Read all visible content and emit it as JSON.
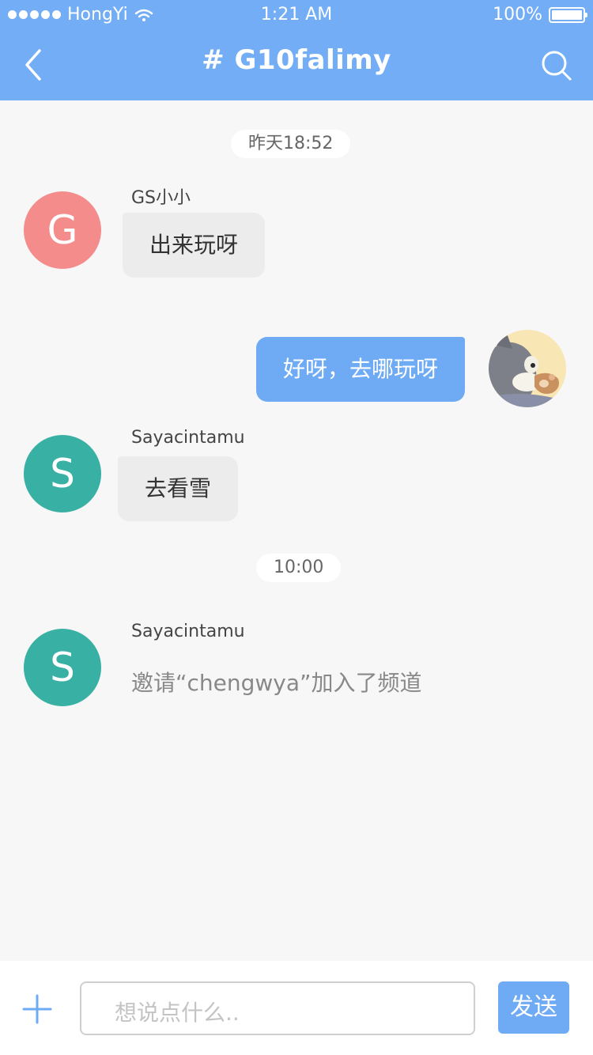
{
  "status_bar": {
    "carrier": "HongYi",
    "time": "1:21 AM",
    "battery": "100%",
    "battery_level": 1.0
  },
  "nav": {
    "title": "# G10falimy",
    "back_icon": "chevron-left-icon",
    "search_icon": "search-icon"
  },
  "messages": {
    "time1": "昨天18:52",
    "m1": {
      "sender": "GS小小",
      "avatar_letter": "G",
      "avatar_color": "#f48c8c",
      "text": "出来玩呀"
    },
    "m2": {
      "text": "好呀，去哪玩呀"
    },
    "m3": {
      "sender": "Sayacintamu",
      "avatar_letter": "S",
      "avatar_color": "#38b0a3",
      "text": "去看雪"
    },
    "time2": "10:00",
    "m4": {
      "sender": "Sayacintamu",
      "avatar_letter": "S",
      "avatar_color": "#38b0a3",
      "text": "邀请“chengwya”加入了频道"
    }
  },
  "footer": {
    "input_placeholder": "想说点什么..",
    "send_label": "发送",
    "plus_icon": "plus-icon"
  },
  "colors": {
    "accent": "#72adf5",
    "outgoing_bubble": "#6eabf4",
    "incoming_bubble": "#ececec"
  }
}
